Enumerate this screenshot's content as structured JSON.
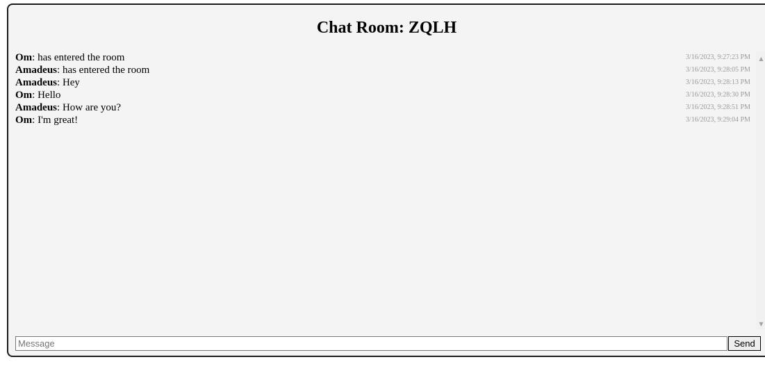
{
  "room": {
    "title": "Chat Room: ZQLH"
  },
  "messages": [
    {
      "author": "Om",
      "separator": ":",
      "text": " has entered the room",
      "time": "3/16/2023, 9:27:23 PM"
    },
    {
      "author": "Amadeus",
      "separator": ":",
      "text": " has entered the room",
      "time": "3/16/2023, 9:28:05 PM"
    },
    {
      "author": "Amadeus",
      "separator": ":",
      "text": " Hey",
      "time": "3/16/2023, 9:28:13 PM"
    },
    {
      "author": "Om",
      "separator": ":",
      "text": " Hello",
      "time": "3/16/2023, 9:28:30 PM"
    },
    {
      "author": "Amadeus",
      "separator": ":",
      "text": " How are you?",
      "time": "3/16/2023, 9:28:51 PM"
    },
    {
      "author": "Om",
      "separator": ":",
      "text": " I'm great!",
      "time": "3/16/2023, 9:29:04 PM"
    }
  ],
  "composer": {
    "placeholder": "Message",
    "value": "",
    "send_label": "Send"
  },
  "icons": {
    "scroll_up": "scroll-up-arrow-icon",
    "scroll_down": "scroll-down-arrow-icon"
  },
  "colors": {
    "panel_background": "#f4f4f4",
    "border": "#1a1a1a",
    "timestamp": "#9a9a9a"
  }
}
